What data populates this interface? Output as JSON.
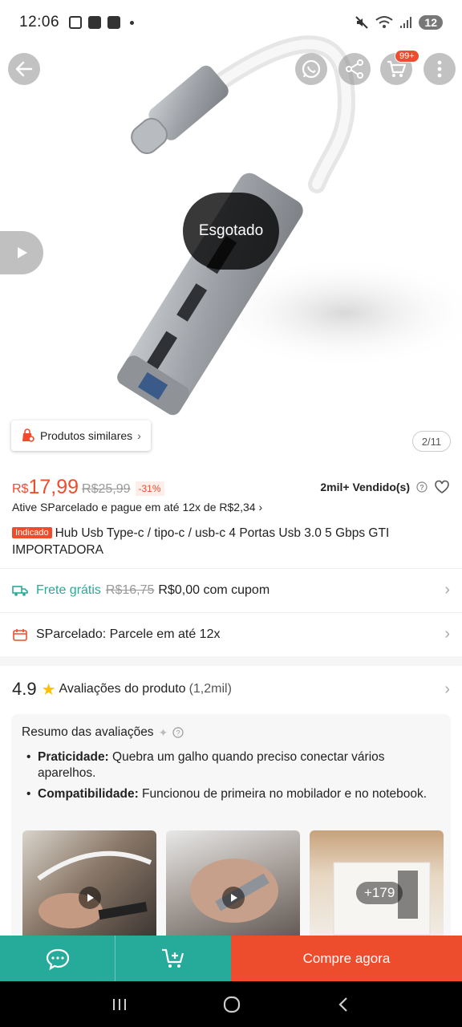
{
  "status_bar": {
    "time": "12:06",
    "battery": "12"
  },
  "header": {
    "cart_badge": "99+"
  },
  "gallery": {
    "soldout_label": "Esgotado",
    "similar_label": "Produtos similares",
    "image_counter": "2/11"
  },
  "product": {
    "currency": "R$",
    "price": "17,99",
    "old_price": "R$25,99",
    "discount": "-31%",
    "sold": "2mil+ Vendido(s)",
    "installment_line": "Ative SParcelado e pague em até 12x de R$2,34",
    "tag": "Indicado",
    "title": "Hub Usb Type-c / tipo-c / usb-c 4 Portas Usb 3.0 5 Gbps GTI IMPORTADORA"
  },
  "shipping": {
    "label": "Frete grátis",
    "old_price": "R$16,75",
    "new_price": "R$0,00 com cupom"
  },
  "sparcelado": {
    "label": "SParcelado: Parcele em até 12x"
  },
  "ratings": {
    "score": "4.9",
    "label": "Avaliações do produto",
    "count": "(1,2mil)",
    "summary_title": "Resumo das avaliações",
    "points": [
      {
        "key": "Praticidade:",
        "text": " Quebra um galho quando preciso conectar vários aparelhos."
      },
      {
        "key": "Compatibilidade:",
        "text": " Funcionou de primeira no mobilador e no notebook."
      }
    ],
    "more_photos": "+179"
  },
  "actions": {
    "buy_label": "Compre agora"
  },
  "colors": {
    "brand": "#ee4d2d",
    "teal": "#26aa99"
  }
}
